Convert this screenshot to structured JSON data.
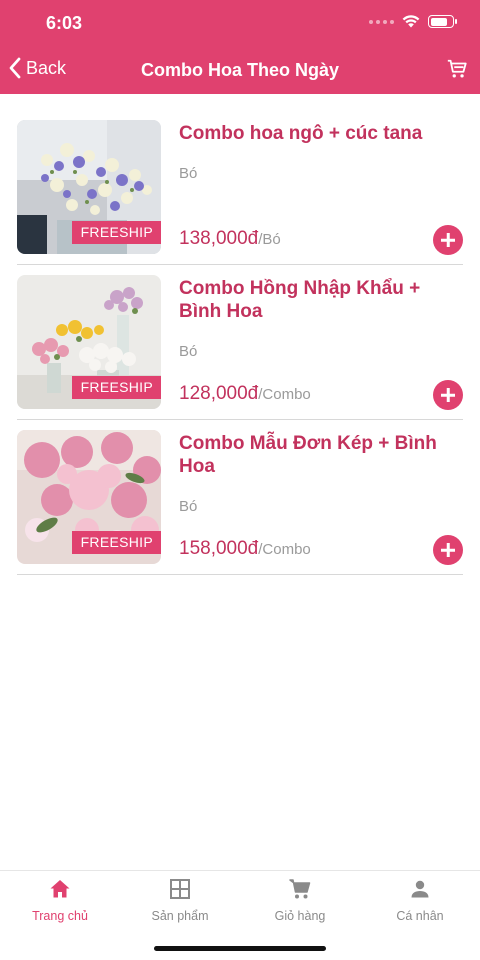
{
  "status_bar": {
    "time": "6:03"
  },
  "nav": {
    "back_label": "Back",
    "title": "Combo Hoa Theo Ngày"
  },
  "colors": {
    "brand": "#e0416f",
    "title_text": "#c2325d",
    "muted": "#9a9a9a"
  },
  "products": [
    {
      "title": "Combo hoa ngô + cúc tana",
      "unit": "Bó",
      "price": "138,000đ",
      "per": "/Bó",
      "badge": "FREESHIP"
    },
    {
      "title": "Combo Hồng Nhập Khẩu + Bình Hoa",
      "unit": "Bó",
      "price": "128,000đ",
      "per": "/Combo",
      "badge": "FREESHIP"
    },
    {
      "title": "Combo Mẫu Đơn Kép + Bình Hoa",
      "unit": "Bó",
      "price": "158,000đ",
      "per": "/Combo",
      "badge": "FREESHIP"
    }
  ],
  "tabs": [
    {
      "label": "Trang chủ",
      "icon": "home-icon",
      "active": true
    },
    {
      "label": "Sản phẩm",
      "icon": "grid-icon",
      "active": false
    },
    {
      "label": "Giỏ hàng",
      "icon": "cart-icon",
      "active": false
    },
    {
      "label": "Cá nhân",
      "icon": "person-icon",
      "active": false
    }
  ]
}
